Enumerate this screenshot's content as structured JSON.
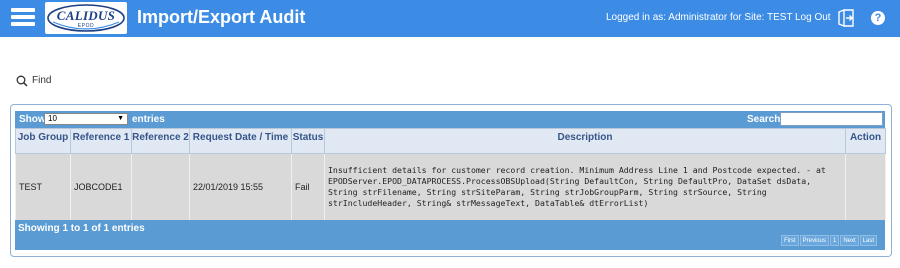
{
  "header": {
    "logo_main": "CALIDUS",
    "logo_sub": "EPOD",
    "title": "Import/Export Audit",
    "logged_in": "Logged in as: Administrator for Site: TEST",
    "logout_label": "Log Out",
    "help_glyph": "?",
    "icons": [
      "hamburger-menu-icon",
      "logout-icon",
      "help-icon"
    ],
    "colors": {
      "bar": "#3c8ce6",
      "logo_text": "#1d3f86"
    }
  },
  "find": {
    "label": "Find",
    "icon": "search-icon"
  },
  "table_controls": {
    "show_label": "Show",
    "entries_value": "10",
    "entries_label": "entries",
    "search_label": "Search:",
    "search_value": ""
  },
  "table": {
    "columns": [
      "Job Group",
      "Reference 1",
      "Reference 2",
      "Request Date / Time",
      "Status",
      "Description",
      "Action"
    ],
    "rows": [
      {
        "job_group": "TEST",
        "reference1": "JOBCODE1",
        "reference2": "",
        "request_datetime": "22/01/2019 15:55",
        "status": "Fail",
        "description": "Insufficient details for customer record creation. Minimum Address Line 1 and Postcode expected. - at EPODServer.EPOD_DATAPROCESS.ProcessOBSUpload(String DefaultCon, String DefaultPro, DataSet dsData, String strFilename, String strSiteParam, String strJobGroupParm, String strSource, String strIncludeHeader, String& strMessageText, DataTable& dtErrorList)",
        "action": ""
      }
    ],
    "colors": {
      "toolbar": "#5a9bd4",
      "header_text": "#37558a",
      "row_bg": "#d9d9d9"
    }
  },
  "footer": {
    "info": "Showing 1 to 1 of 1 entries",
    "pager": {
      "first": "First",
      "previous": "Previous",
      "page": "1",
      "next": "Next",
      "last": "Last"
    }
  }
}
